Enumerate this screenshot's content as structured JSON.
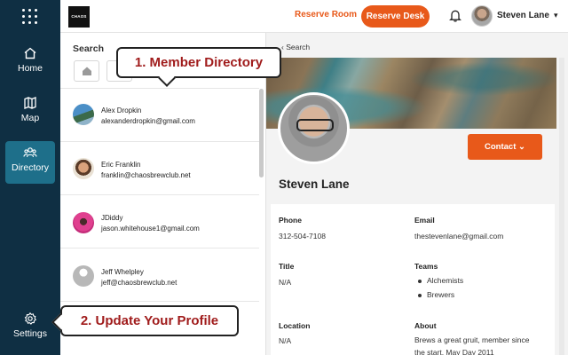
{
  "sidebar": {
    "items": [
      {
        "label": "Home"
      },
      {
        "label": "Map"
      },
      {
        "label": "Directory"
      },
      {
        "label": "Settings"
      }
    ]
  },
  "topbar": {
    "logo_text": "CHAOS",
    "reserve_room": "Reserve Room",
    "reserve_desk": "Reserve Desk",
    "user_name": "Steven Lane",
    "caret": "▾"
  },
  "list": {
    "search_title": "Search",
    "members": [
      {
        "name": "Alex Dropkin",
        "email": "alexanderdropkin@gmail.com"
      },
      {
        "name": "Eric Franklin",
        "email": "franklin@chaosbrewclub.net"
      },
      {
        "name": "JDiddy",
        "email": "jason.whitehouse1@gmail.com"
      },
      {
        "name": "Jeff Whelpley",
        "email": "jeff@chaosbrewclub.net"
      }
    ]
  },
  "profile": {
    "back_label": "‹ Search",
    "contact_label": "Contact ⌄",
    "name": "Steven Lane",
    "phone_label": "Phone",
    "phone": "312-504-7108",
    "email_label": "Email",
    "email": "thestevenlane@gmail.com",
    "title_label": "Title",
    "title": "N/A",
    "teams_label": "Teams",
    "teams": [
      "Alchemists",
      "Brewers"
    ],
    "location_label": "Location",
    "location": "N/A",
    "about_label": "About",
    "about": "Brews a great gruit, member since the start. May Day 2011"
  },
  "callouts": {
    "member_directory": "1. Member Directory",
    "update_profile": "2. Update Your Profile"
  }
}
